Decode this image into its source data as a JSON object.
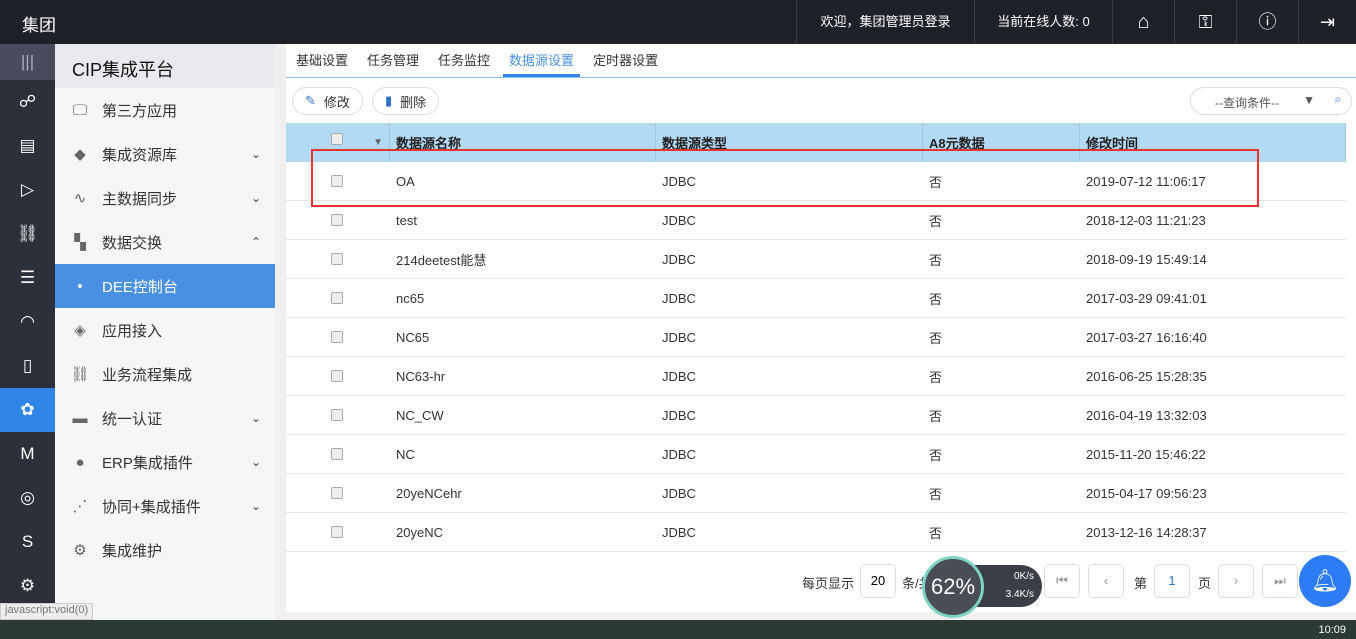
{
  "header": {
    "brand": "集团",
    "welcome": "欢迎，集团管理员登录",
    "online": "当前在线人数: 0"
  },
  "sidebar": {
    "title": "CIP集成平台",
    "items": [
      {
        "label": "第三方应用",
        "icon": "monitor-icon",
        "expand": ""
      },
      {
        "label": "集成资源库",
        "icon": "tag-icon",
        "expand": "⌄"
      },
      {
        "label": "主数据同步",
        "icon": "chart-icon",
        "expand": "⌄"
      },
      {
        "label": "数据交换",
        "icon": "exchange-icon",
        "expand": "⌃"
      },
      {
        "label": "DEE控制台",
        "icon": "dot-icon",
        "expand": ""
      },
      {
        "label": "应用接入",
        "icon": "cube-icon",
        "expand": ""
      },
      {
        "label": "业务流程集成",
        "icon": "flow-icon",
        "expand": ""
      },
      {
        "label": "统一认证",
        "icon": "id-icon",
        "expand": "⌄"
      },
      {
        "label": "ERP集成插件",
        "icon": "erp-icon",
        "expand": "⌄"
      },
      {
        "label": "协同+集成插件",
        "icon": "share-icon",
        "expand": "⌄"
      },
      {
        "label": "集成维护",
        "icon": "gear-icon",
        "expand": ""
      }
    ]
  },
  "tabs": [
    "基础设置",
    "任务管理",
    "任务监控",
    "数据源设置",
    "定时器设置"
  ],
  "toolbar": {
    "edit": "修改",
    "delete": "删除",
    "search_placeholder": "--查询条件--"
  },
  "table": {
    "headers": [
      "数据源名称",
      "数据源类型",
      "A8元数据",
      "修改时间"
    ],
    "rows": [
      [
        "OA",
        "JDBC",
        "否",
        "2019-07-12 11:06:17"
      ],
      [
        "test",
        "JDBC",
        "否",
        "2018-12-03 11:21:23"
      ],
      [
        "214deetest能慧",
        "JDBC",
        "否",
        "2018-09-19 15:49:14"
      ],
      [
        "nc65",
        "JDBC",
        "否",
        "2017-03-29 09:41:01"
      ],
      [
        "NC65",
        "JDBC",
        "否",
        "2017-03-27 16:16:40"
      ],
      [
        "NC63-hr",
        "JDBC",
        "否",
        "2016-06-25 15:28:35"
      ],
      [
        "NC_CW",
        "JDBC",
        "否",
        "2016-04-19 13:32:03"
      ],
      [
        "NC",
        "JDBC",
        "否",
        "2015-11-20 15:46:22"
      ],
      [
        "20yeNCehr",
        "JDBC",
        "否",
        "2015-04-17 09:56:23"
      ],
      [
        "20yeNC",
        "JDBC",
        "否",
        "2013-12-16 14:28:37"
      ]
    ]
  },
  "pagination": {
    "per_page_label": "每页显示",
    "per_page": "20",
    "total_label": "条/共",
    "page_label": "第",
    "page": "1",
    "page_unit": "页"
  },
  "widget": {
    "cpu": "62%",
    "up": "0K/s",
    "down": "3.4K/s"
  },
  "status_bar": "javascript:void(0)",
  "taskbar": {
    "clock": "10:09"
  }
}
